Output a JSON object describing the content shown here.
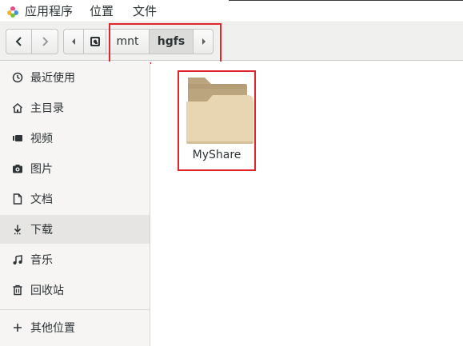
{
  "menubar": {
    "applications": "应用程序",
    "places": "位置",
    "file": "文件"
  },
  "pathbar": {
    "segments": [
      "mnt",
      "hgfs"
    ],
    "current": "hgfs"
  },
  "sidebar": {
    "items": [
      {
        "label": "最近使用",
        "icon": "clock-icon"
      },
      {
        "label": "主目录",
        "icon": "home-icon"
      },
      {
        "label": "视频",
        "icon": "video-icon"
      },
      {
        "label": "图片",
        "icon": "camera-icon"
      },
      {
        "label": "文档",
        "icon": "document-icon"
      },
      {
        "label": "下载",
        "icon": "download-icon",
        "active": true
      },
      {
        "label": "音乐",
        "icon": "music-icon"
      },
      {
        "label": "回收站",
        "icon": "trash-icon"
      },
      {
        "label": "其他位置",
        "icon": "plus-icon"
      }
    ]
  },
  "files": [
    {
      "name": "MyShare",
      "type": "folder"
    }
  ],
  "colors": {
    "highlight": "#e0262b",
    "folder_body": "#e8d5b2",
    "folder_back": "#bba57e"
  }
}
